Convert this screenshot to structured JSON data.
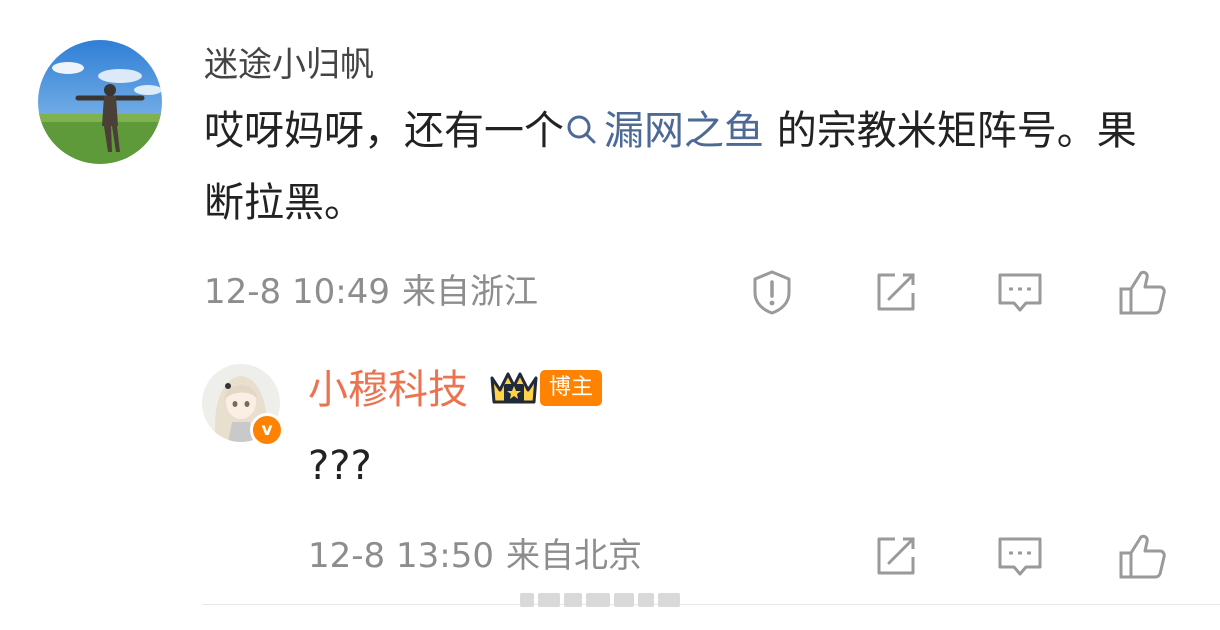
{
  "colors": {
    "link": "#4d6a97",
    "meta": "#8d8d8d",
    "orange": "#ff8200",
    "text": "#222222"
  },
  "comment": {
    "username": "迷途小归帆",
    "text_before": "哎呀妈呀，还有一个",
    "topic": "漏网之鱼",
    "text_after": " 的宗教米矩阵号。果断拉黑。",
    "date_time": "12-8 10:49",
    "location": "来自浙江",
    "actions": [
      "report-icon",
      "repost-icon",
      "comment-icon",
      "like-icon"
    ]
  },
  "reply": {
    "username": "小穆科技",
    "crown_badge": "crown-icon",
    "role_badge": "博主",
    "verified_icon": "v",
    "text": "???",
    "date_time": "12-8 13:50",
    "location": "来自北京",
    "actions": [
      "repost-icon",
      "comment-icon",
      "like-icon"
    ]
  }
}
